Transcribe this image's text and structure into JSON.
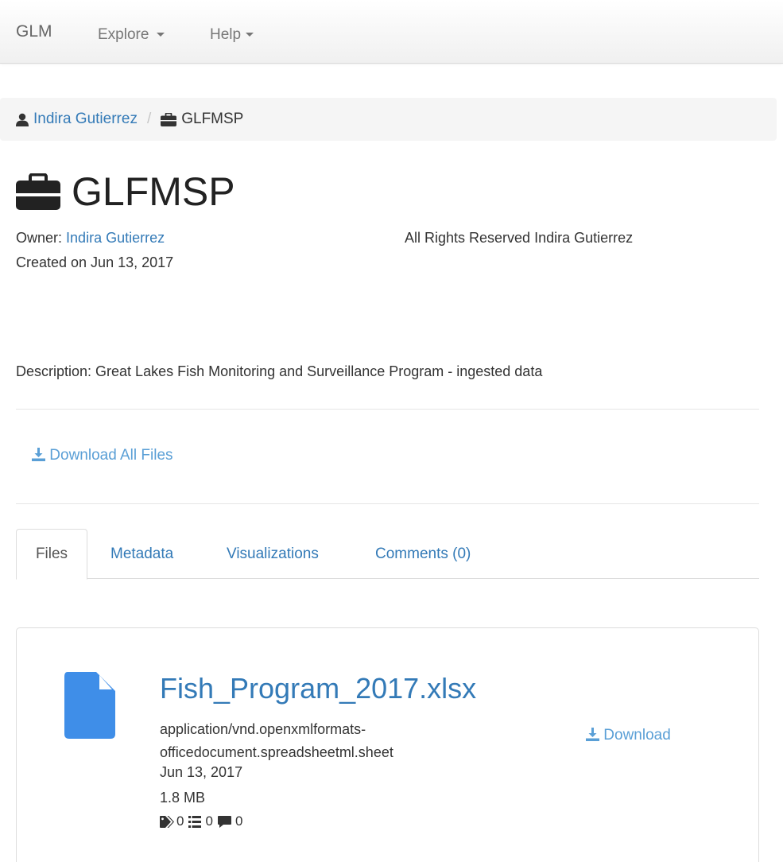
{
  "navbar": {
    "brand": "GLM",
    "explore": "Explore",
    "help": "Help"
  },
  "breadcrumb": {
    "owner": "Indira Gutierrez",
    "separator": "/",
    "current": "GLFMSP"
  },
  "dataset": {
    "title": "GLFMSP",
    "owner_label": "Owner:",
    "owner_name": "Indira Gutierrez",
    "created": "Created on Jun 13, 2017",
    "rights": "All Rights Reserved Indira Gutierrez",
    "description": "Description: Great Lakes Fish Monitoring and Surveillance Program - ingested data",
    "download_all": "Download All Files"
  },
  "tabs": {
    "files": "Files",
    "metadata": "Metadata",
    "visualizations": "Visualizations",
    "comments": "Comments (0)"
  },
  "file": {
    "name": "Fish_Program_2017.xlsx",
    "type_line1": "application/vnd.openxmlformats-",
    "type_line2": "officedocument.spreadsheetml.sheet",
    "date": "Jun 13, 2017",
    "size": "1.8 MB",
    "tags_count": "0",
    "metadata_count": "0",
    "comments_count": "0",
    "download": "Download"
  },
  "colors": {
    "link": "#337ab7",
    "download_link": "#5a9fd6",
    "file_icon": "#3f8ee8"
  },
  "icons": {
    "user": "user-icon",
    "briefcase": "briefcase-icon",
    "download": "download-icon",
    "file": "file-icon",
    "tags": "tags-icon",
    "list": "list-icon",
    "comment": "comment-icon"
  }
}
